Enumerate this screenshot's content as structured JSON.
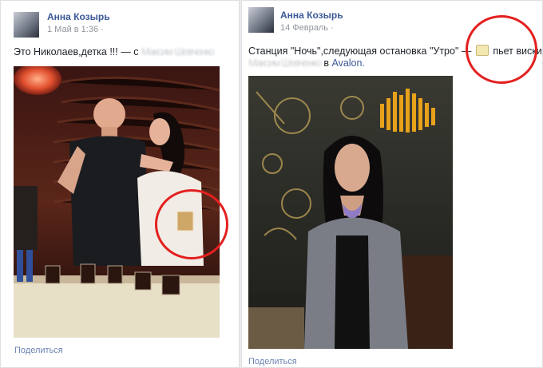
{
  "post1": {
    "author": "Анна Козырь",
    "date": "1 Май в 1:36",
    "text_start": "Это Николаев,детка !!! — с",
    "tagged_names": "Максим Шевченко",
    "share_label": "Поделиться"
  },
  "post2": {
    "author": "Анна Козырь",
    "date": "14 Февраль",
    "text_main": "Станция \"Ночь\",следующая остановка \"Утро\" —",
    "activity": "пьет виски",
    "tagged_names": "Максим Шевченко",
    "place_prefix": "в",
    "place": "Avalon.",
    "share_label": "Поделиться"
  },
  "colors": {
    "link": "#3b5998",
    "highlight_circle": "#e3201f"
  }
}
